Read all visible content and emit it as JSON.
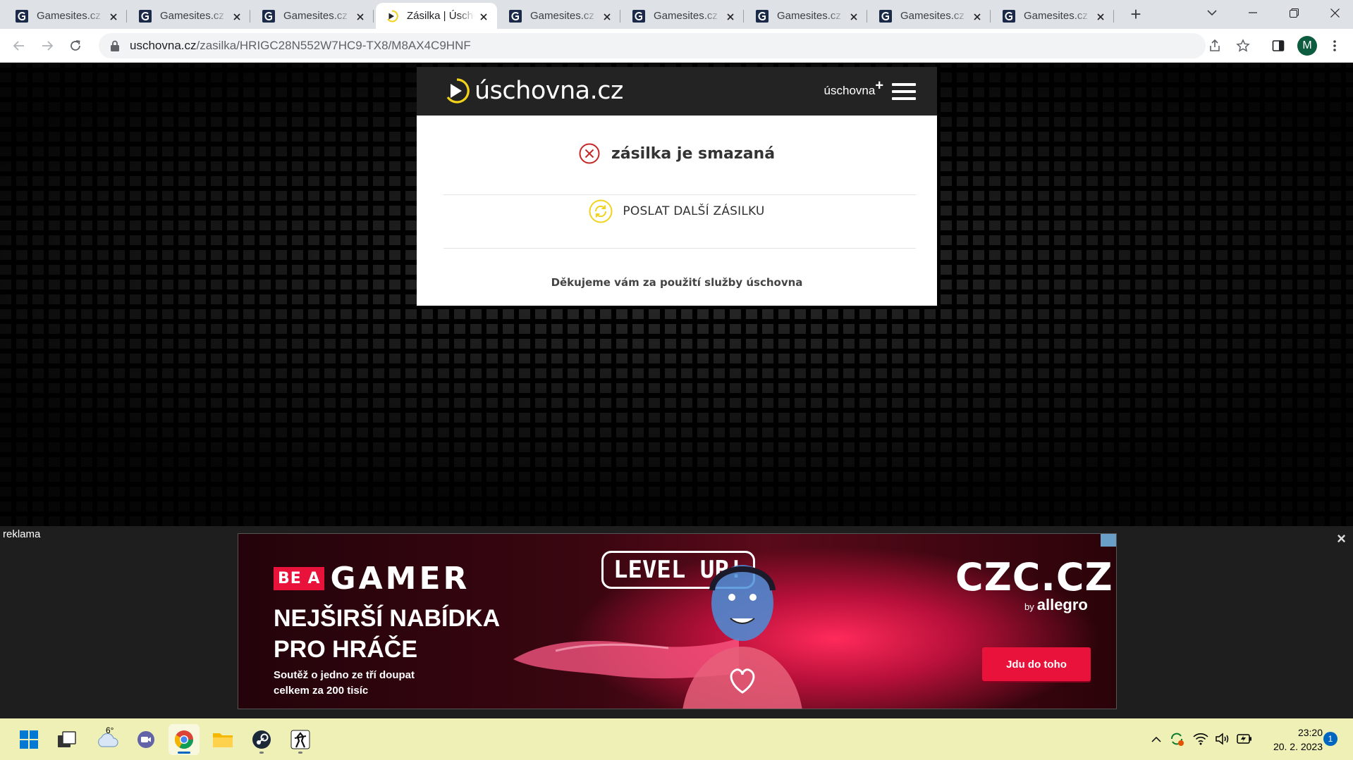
{
  "browser": {
    "tabs": [
      {
        "title": "Gamesites.cz - ",
        "favicon": "gamesites-icon",
        "active": false
      },
      {
        "title": "Gamesites.cz - ",
        "favicon": "gamesites-icon",
        "active": false
      },
      {
        "title": "Gamesites.cz - ",
        "favicon": "gamesites-icon",
        "active": false
      },
      {
        "title": "Zásilka | Úschovna",
        "favicon": "uschovna-icon",
        "active": true
      },
      {
        "title": "Gamesites.cz - ",
        "favicon": "gamesites-icon",
        "active": false
      },
      {
        "title": "Gamesites.cz - ",
        "favicon": "gamesites-icon",
        "active": false
      },
      {
        "title": "Gamesites.cz - ",
        "favicon": "gamesites-icon",
        "active": false
      },
      {
        "title": "Gamesites.cz - ",
        "favicon": "gamesites-icon",
        "active": false
      },
      {
        "title": "Gamesites.cz - ",
        "favicon": "gamesites-icon",
        "active": false
      }
    ],
    "new_tab": "+",
    "url_host": "uschovna.cz",
    "url_path": "/zasilka/HRIGC28N552W7HC9-TX8/M8AX4C9HNF",
    "profile_initial": "M"
  },
  "page": {
    "logo_text": "úschovna.cz",
    "plus_link": "úschovna",
    "plus_sign": "+",
    "status_text": "zásilka je smazaná",
    "send_more": "POSLAT DALŠÍ ZÁSILKU",
    "thanks": "Děkujeme vám za použití služby úschovna"
  },
  "ad": {
    "label": "reklama",
    "close": "×",
    "be_a": "BE A",
    "gamer": "GAMER",
    "headline_1": "NEJŠIRŠÍ NABÍDKA",
    "headline_2": "PRO HRÁČE",
    "small_1": "Soutěž o jedno ze tří doupat",
    "small_2": "celkem za 200 tisíc",
    "level_up": "LEVEL UP!",
    "brand": "CZC.CZ",
    "by": "by",
    "allegro": "allegro",
    "cta": "Jdu do toho"
  },
  "taskbar": {
    "weather_temp": "6°",
    "time": "23:20",
    "date": "20. 2. 2023",
    "notifications": "1"
  },
  "colors": {
    "accent_yellow": "#f3d21c",
    "error_red": "#c62828",
    "ad_red": "#e8123a",
    "taskbar_bg": "#eef0b6"
  }
}
